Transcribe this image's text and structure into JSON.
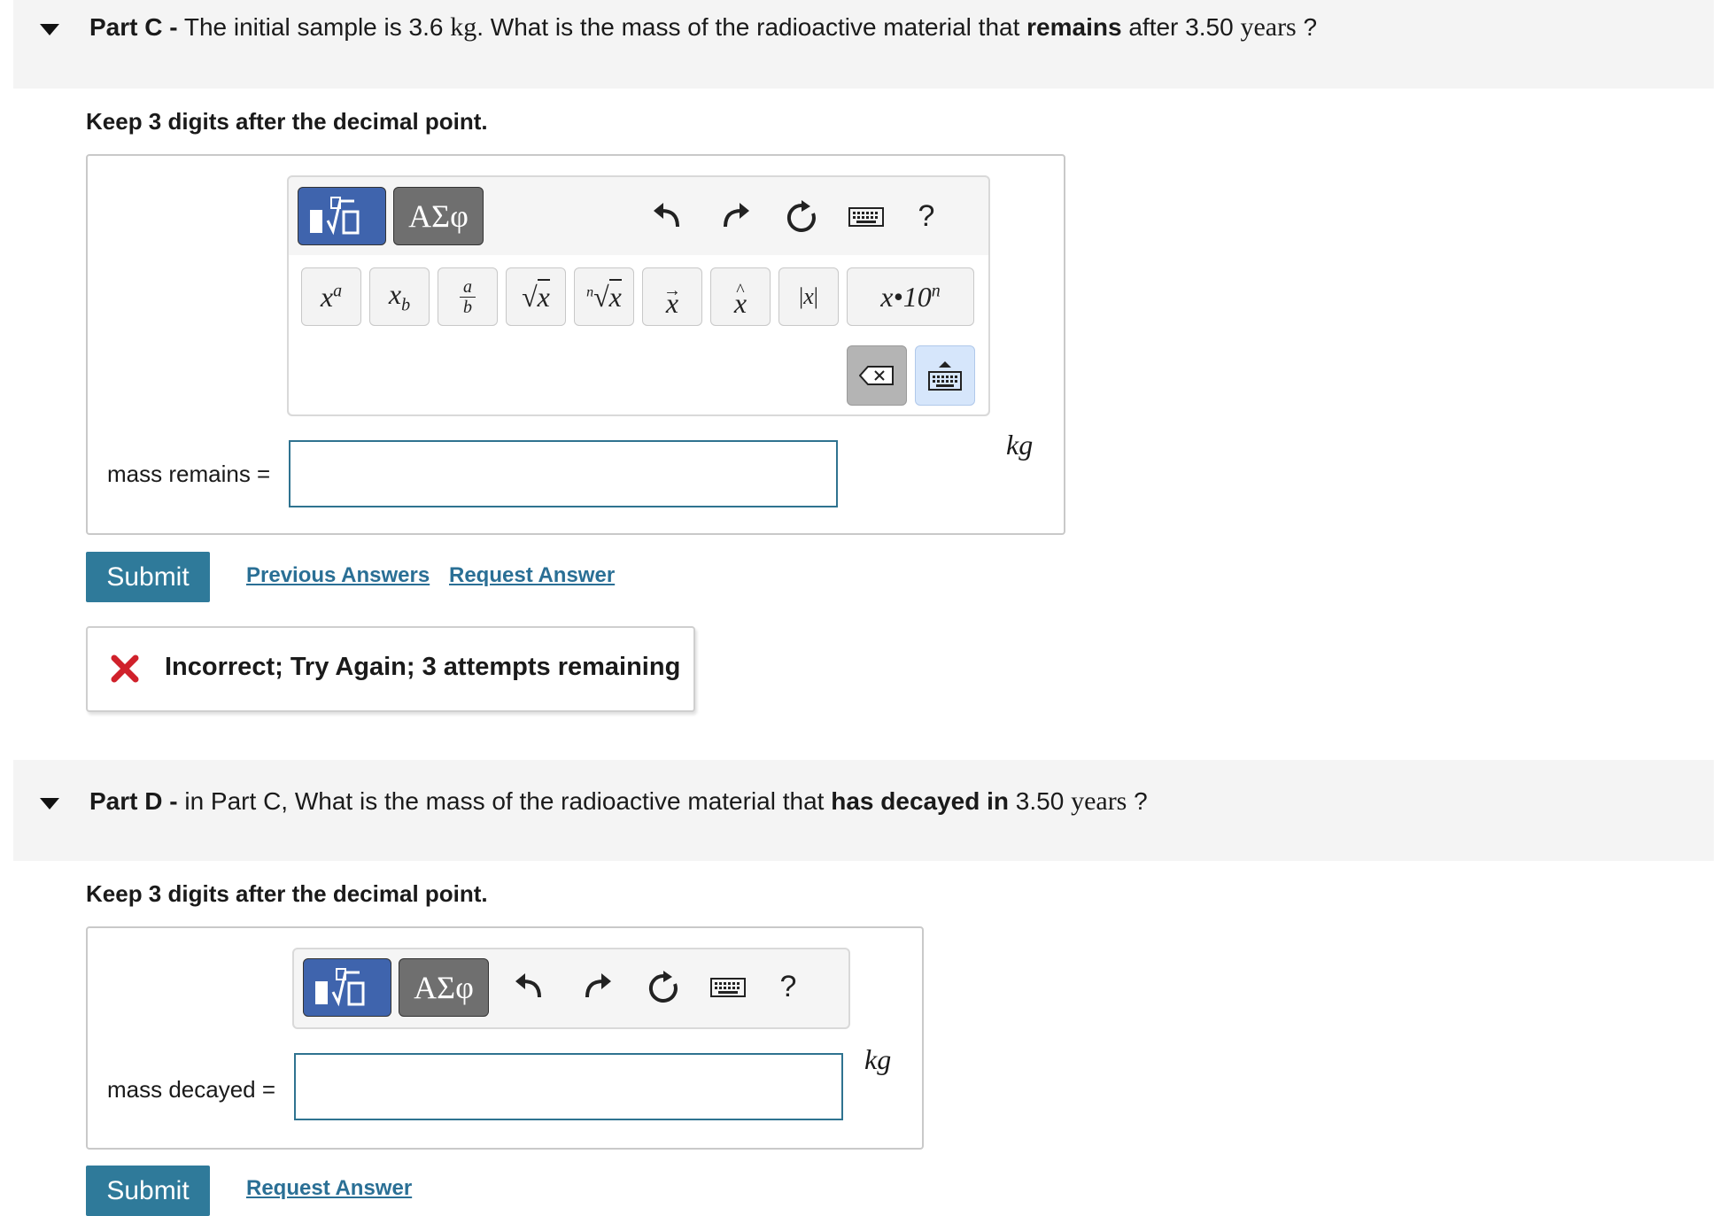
{
  "colors": {
    "accent": "#2f7a9a",
    "link": "#2a6f95",
    "input_border": "#2f7390",
    "error": "#d0212b",
    "math_mode": "#3f64ad",
    "greek_mode": "#6f6f6f"
  },
  "part_c": {
    "label": "Part C -",
    "text_1": "The initial sample is 3.6",
    "unit_kg": "kg",
    "text_2": ". What is the mass of the radioactive material that",
    "bold": "remains",
    "text_3": "after 3.50",
    "unit_years": "years",
    "text_4": "?",
    "instruction": "Keep 3 digits after the decimal point.",
    "toolbar": {
      "greek_label": "ΑΣφ",
      "help_label": "?",
      "keys": [
        "xᵃ",
        "x_b",
        "a/b",
        "√x",
        "ⁿ√x",
        "x⃗",
        "x̂",
        "|x|",
        "x·10ⁿ"
      ]
    },
    "field_label": "mass remains =",
    "input_value": "",
    "unit": "kg",
    "submit_label": "Submit",
    "previous_answers": "Previous Answers",
    "request_answer": "Request Answer",
    "feedback": "Incorrect; Try Again; 3 attempts remaining"
  },
  "part_d": {
    "label": "Part D -",
    "text_1": "in Part C,  What is the mass of the radioactive material that",
    "bold": "has decayed in",
    "text_2": "3.50",
    "unit_years": "years",
    "text_3": "?",
    "instruction": "Keep 3 digits after the decimal point.",
    "toolbar": {
      "greek_label": "ΑΣφ",
      "help_label": "?"
    },
    "field_label": "mass decayed =",
    "input_value": "",
    "unit": "kg",
    "submit_label": "Submit",
    "request_answer": "Request Answer"
  }
}
